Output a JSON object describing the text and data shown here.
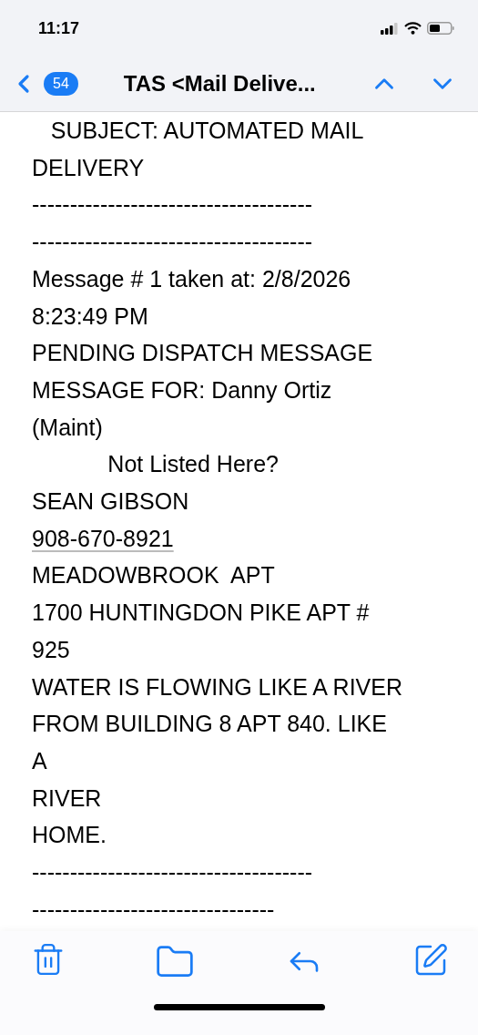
{
  "status_bar": {
    "time": "11:17"
  },
  "nav": {
    "unread_count": "54",
    "title": "TAS <Mail Delive..."
  },
  "body_lines": [
    {
      "kind": "text",
      "text": "   SUBJECT: AUTOMATED MAIL"
    },
    {
      "kind": "text",
      "text": "DELIVERY"
    },
    {
      "kind": "text",
      "text": "-------------------------------------"
    },
    {
      "kind": "text",
      "text": "-------------------------------------"
    },
    {
      "kind": "text",
      "text": "Message # 1 taken at: 2/8/2026"
    },
    {
      "kind": "text",
      "text": "8:23:49 PM"
    },
    {
      "kind": "text",
      "text": "PENDING DISPATCH MESSAGE"
    },
    {
      "kind": "text",
      "text": "MESSAGE FOR: Danny Ortiz"
    },
    {
      "kind": "text",
      "text": "(Maint)"
    },
    {
      "kind": "text",
      "text": "            Not Listed Here?"
    },
    {
      "kind": "text",
      "text": "SEAN GIBSON"
    },
    {
      "kind": "link",
      "text": "908-670-8921"
    },
    {
      "kind": "text",
      "text": "MEADOWBROOK  APT"
    },
    {
      "kind": "text",
      "text": "1700 HUNTINGDON PIKE APT #"
    },
    {
      "kind": "text",
      "text": "925"
    },
    {
      "kind": "text",
      "text": "WATER IS FLOWING LIKE A RIVER"
    },
    {
      "kind": "text",
      "text": "FROM BUILDING 8 APT 840. LIKE"
    },
    {
      "kind": "text",
      "text": "A"
    },
    {
      "kind": "text",
      "text": "RIVER"
    },
    {
      "kind": "text",
      "text": "HOME."
    },
    {
      "kind": "text",
      "text": "-------------------------------------"
    },
    {
      "kind": "text",
      "text": "--------------------------------"
    }
  ]
}
